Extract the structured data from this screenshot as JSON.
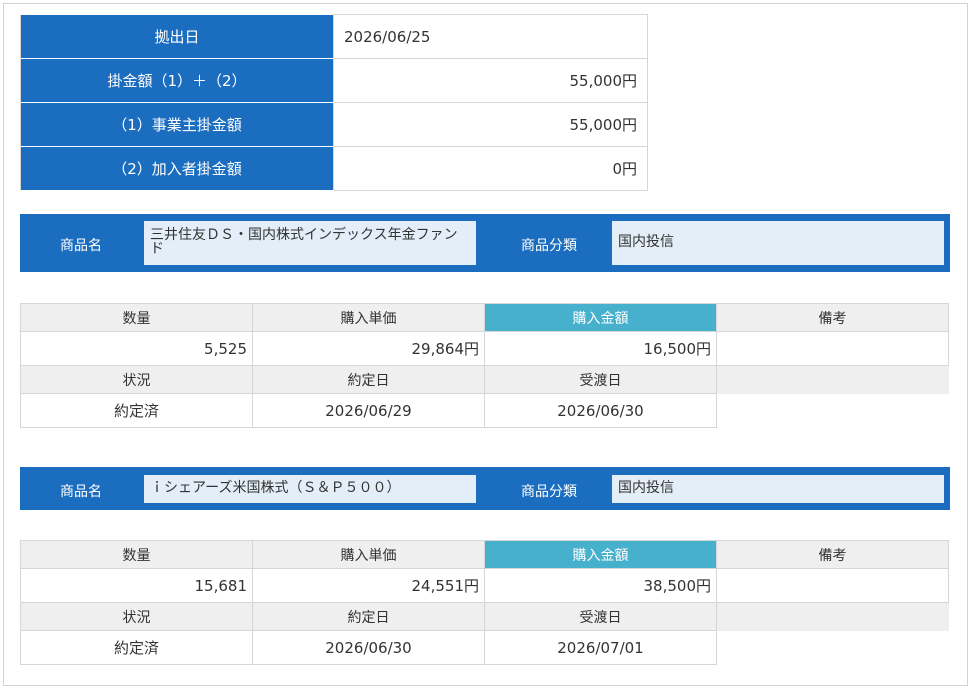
{
  "summary": {
    "date_label": "拠出日",
    "date_value": "2026/06/25",
    "total_label": "掛金額（1）＋（2）",
    "total_value": "55,000円",
    "employer_label": "（1）事業主掛金額",
    "employer_value": "55,000円",
    "member_label": "（2）加入者掛金額",
    "member_value": "0円"
  },
  "labels": {
    "product_name": "商品名",
    "product_category": "商品分類",
    "quantity": "数量",
    "unit_price": "購入単価",
    "amount": "購入金額",
    "remarks": "備考",
    "status": "状況",
    "contract_date": "約定日",
    "delivery_date": "受渡日"
  },
  "products": [
    {
      "name": "三井住友ＤＳ・国内株式インデックス年金ファンド",
      "category": "国内投信",
      "quantity": "5,525",
      "unit_price": "29,864円",
      "amount": "16,500円",
      "remarks": "",
      "status": "約定済",
      "contract_date": "2026/06/29",
      "delivery_date": "2026/06/30"
    },
    {
      "name": "ｉシェアーズ米国株式（Ｓ＆Ｐ５００）",
      "category": "国内投信",
      "quantity": "15,681",
      "unit_price": "24,551円",
      "amount": "38,500円",
      "remarks": "",
      "status": "約定済",
      "contract_date": "2026/06/30",
      "delivery_date": "2026/07/01"
    }
  ],
  "colors": {
    "header_blue": "#1b6dbf",
    "highlight_teal": "#46b0cd",
    "header_gray": "#efefef",
    "box_bg": "#e3eef8"
  }
}
